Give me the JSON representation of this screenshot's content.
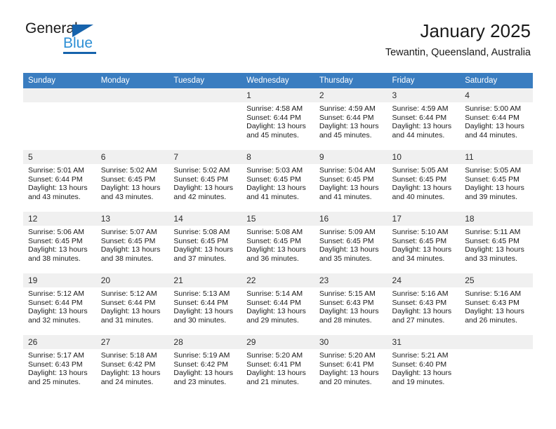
{
  "brand": {
    "name_part1": "General",
    "name_part2": "Blue",
    "triangle_color": "#1663ac",
    "blue_text_color": "#2d8fd5"
  },
  "header": {
    "title": "January 2025",
    "subtitle": "Tewantin, Queensland, Australia"
  },
  "theme": {
    "header_row_bg": "#3a7dc0",
    "header_row_text": "#ffffff",
    "day_number_bg": "#f0f0f0",
    "week_separator": "#2f6ca8"
  },
  "weekday_headers": [
    "Sunday",
    "Monday",
    "Tuesday",
    "Wednesday",
    "Thursday",
    "Friday",
    "Saturday"
  ],
  "weeks": [
    [
      {
        "day": "",
        "sunrise": "",
        "sunset": "",
        "daylight1": "",
        "daylight2": ""
      },
      {
        "day": "",
        "sunrise": "",
        "sunset": "",
        "daylight1": "",
        "daylight2": ""
      },
      {
        "day": "",
        "sunrise": "",
        "sunset": "",
        "daylight1": "",
        "daylight2": ""
      },
      {
        "day": "1",
        "sunrise": "Sunrise: 4:58 AM",
        "sunset": "Sunset: 6:44 PM",
        "daylight1": "Daylight: 13 hours",
        "daylight2": "and 45 minutes."
      },
      {
        "day": "2",
        "sunrise": "Sunrise: 4:59 AM",
        "sunset": "Sunset: 6:44 PM",
        "daylight1": "Daylight: 13 hours",
        "daylight2": "and 45 minutes."
      },
      {
        "day": "3",
        "sunrise": "Sunrise: 4:59 AM",
        "sunset": "Sunset: 6:44 PM",
        "daylight1": "Daylight: 13 hours",
        "daylight2": "and 44 minutes."
      },
      {
        "day": "4",
        "sunrise": "Sunrise: 5:00 AM",
        "sunset": "Sunset: 6:44 PM",
        "daylight1": "Daylight: 13 hours",
        "daylight2": "and 44 minutes."
      }
    ],
    [
      {
        "day": "5",
        "sunrise": "Sunrise: 5:01 AM",
        "sunset": "Sunset: 6:44 PM",
        "daylight1": "Daylight: 13 hours",
        "daylight2": "and 43 minutes."
      },
      {
        "day": "6",
        "sunrise": "Sunrise: 5:02 AM",
        "sunset": "Sunset: 6:45 PM",
        "daylight1": "Daylight: 13 hours",
        "daylight2": "and 43 minutes."
      },
      {
        "day": "7",
        "sunrise": "Sunrise: 5:02 AM",
        "sunset": "Sunset: 6:45 PM",
        "daylight1": "Daylight: 13 hours",
        "daylight2": "and 42 minutes."
      },
      {
        "day": "8",
        "sunrise": "Sunrise: 5:03 AM",
        "sunset": "Sunset: 6:45 PM",
        "daylight1": "Daylight: 13 hours",
        "daylight2": "and 41 minutes."
      },
      {
        "day": "9",
        "sunrise": "Sunrise: 5:04 AM",
        "sunset": "Sunset: 6:45 PM",
        "daylight1": "Daylight: 13 hours",
        "daylight2": "and 41 minutes."
      },
      {
        "day": "10",
        "sunrise": "Sunrise: 5:05 AM",
        "sunset": "Sunset: 6:45 PM",
        "daylight1": "Daylight: 13 hours",
        "daylight2": "and 40 minutes."
      },
      {
        "day": "11",
        "sunrise": "Sunrise: 5:05 AM",
        "sunset": "Sunset: 6:45 PM",
        "daylight1": "Daylight: 13 hours",
        "daylight2": "and 39 minutes."
      }
    ],
    [
      {
        "day": "12",
        "sunrise": "Sunrise: 5:06 AM",
        "sunset": "Sunset: 6:45 PM",
        "daylight1": "Daylight: 13 hours",
        "daylight2": "and 38 minutes."
      },
      {
        "day": "13",
        "sunrise": "Sunrise: 5:07 AM",
        "sunset": "Sunset: 6:45 PM",
        "daylight1": "Daylight: 13 hours",
        "daylight2": "and 38 minutes."
      },
      {
        "day": "14",
        "sunrise": "Sunrise: 5:08 AM",
        "sunset": "Sunset: 6:45 PM",
        "daylight1": "Daylight: 13 hours",
        "daylight2": "and 37 minutes."
      },
      {
        "day": "15",
        "sunrise": "Sunrise: 5:08 AM",
        "sunset": "Sunset: 6:45 PM",
        "daylight1": "Daylight: 13 hours",
        "daylight2": "and 36 minutes."
      },
      {
        "day": "16",
        "sunrise": "Sunrise: 5:09 AM",
        "sunset": "Sunset: 6:45 PM",
        "daylight1": "Daylight: 13 hours",
        "daylight2": "and 35 minutes."
      },
      {
        "day": "17",
        "sunrise": "Sunrise: 5:10 AM",
        "sunset": "Sunset: 6:45 PM",
        "daylight1": "Daylight: 13 hours",
        "daylight2": "and 34 minutes."
      },
      {
        "day": "18",
        "sunrise": "Sunrise: 5:11 AM",
        "sunset": "Sunset: 6:45 PM",
        "daylight1": "Daylight: 13 hours",
        "daylight2": "and 33 minutes."
      }
    ],
    [
      {
        "day": "19",
        "sunrise": "Sunrise: 5:12 AM",
        "sunset": "Sunset: 6:44 PM",
        "daylight1": "Daylight: 13 hours",
        "daylight2": "and 32 minutes."
      },
      {
        "day": "20",
        "sunrise": "Sunrise: 5:12 AM",
        "sunset": "Sunset: 6:44 PM",
        "daylight1": "Daylight: 13 hours",
        "daylight2": "and 31 minutes."
      },
      {
        "day": "21",
        "sunrise": "Sunrise: 5:13 AM",
        "sunset": "Sunset: 6:44 PM",
        "daylight1": "Daylight: 13 hours",
        "daylight2": "and 30 minutes."
      },
      {
        "day": "22",
        "sunrise": "Sunrise: 5:14 AM",
        "sunset": "Sunset: 6:44 PM",
        "daylight1": "Daylight: 13 hours",
        "daylight2": "and 29 minutes."
      },
      {
        "day": "23",
        "sunrise": "Sunrise: 5:15 AM",
        "sunset": "Sunset: 6:43 PM",
        "daylight1": "Daylight: 13 hours",
        "daylight2": "and 28 minutes."
      },
      {
        "day": "24",
        "sunrise": "Sunrise: 5:16 AM",
        "sunset": "Sunset: 6:43 PM",
        "daylight1": "Daylight: 13 hours",
        "daylight2": "and 27 minutes."
      },
      {
        "day": "25",
        "sunrise": "Sunrise: 5:16 AM",
        "sunset": "Sunset: 6:43 PM",
        "daylight1": "Daylight: 13 hours",
        "daylight2": "and 26 minutes."
      }
    ],
    [
      {
        "day": "26",
        "sunrise": "Sunrise: 5:17 AM",
        "sunset": "Sunset: 6:43 PM",
        "daylight1": "Daylight: 13 hours",
        "daylight2": "and 25 minutes."
      },
      {
        "day": "27",
        "sunrise": "Sunrise: 5:18 AM",
        "sunset": "Sunset: 6:42 PM",
        "daylight1": "Daylight: 13 hours",
        "daylight2": "and 24 minutes."
      },
      {
        "day": "28",
        "sunrise": "Sunrise: 5:19 AM",
        "sunset": "Sunset: 6:42 PM",
        "daylight1": "Daylight: 13 hours",
        "daylight2": "and 23 minutes."
      },
      {
        "day": "29",
        "sunrise": "Sunrise: 5:20 AM",
        "sunset": "Sunset: 6:41 PM",
        "daylight1": "Daylight: 13 hours",
        "daylight2": "and 21 minutes."
      },
      {
        "day": "30",
        "sunrise": "Sunrise: 5:20 AM",
        "sunset": "Sunset: 6:41 PM",
        "daylight1": "Daylight: 13 hours",
        "daylight2": "and 20 minutes."
      },
      {
        "day": "31",
        "sunrise": "Sunrise: 5:21 AM",
        "sunset": "Sunset: 6:40 PM",
        "daylight1": "Daylight: 13 hours",
        "daylight2": "and 19 minutes."
      },
      {
        "day": "",
        "sunrise": "",
        "sunset": "",
        "daylight1": "",
        "daylight2": ""
      }
    ]
  ]
}
